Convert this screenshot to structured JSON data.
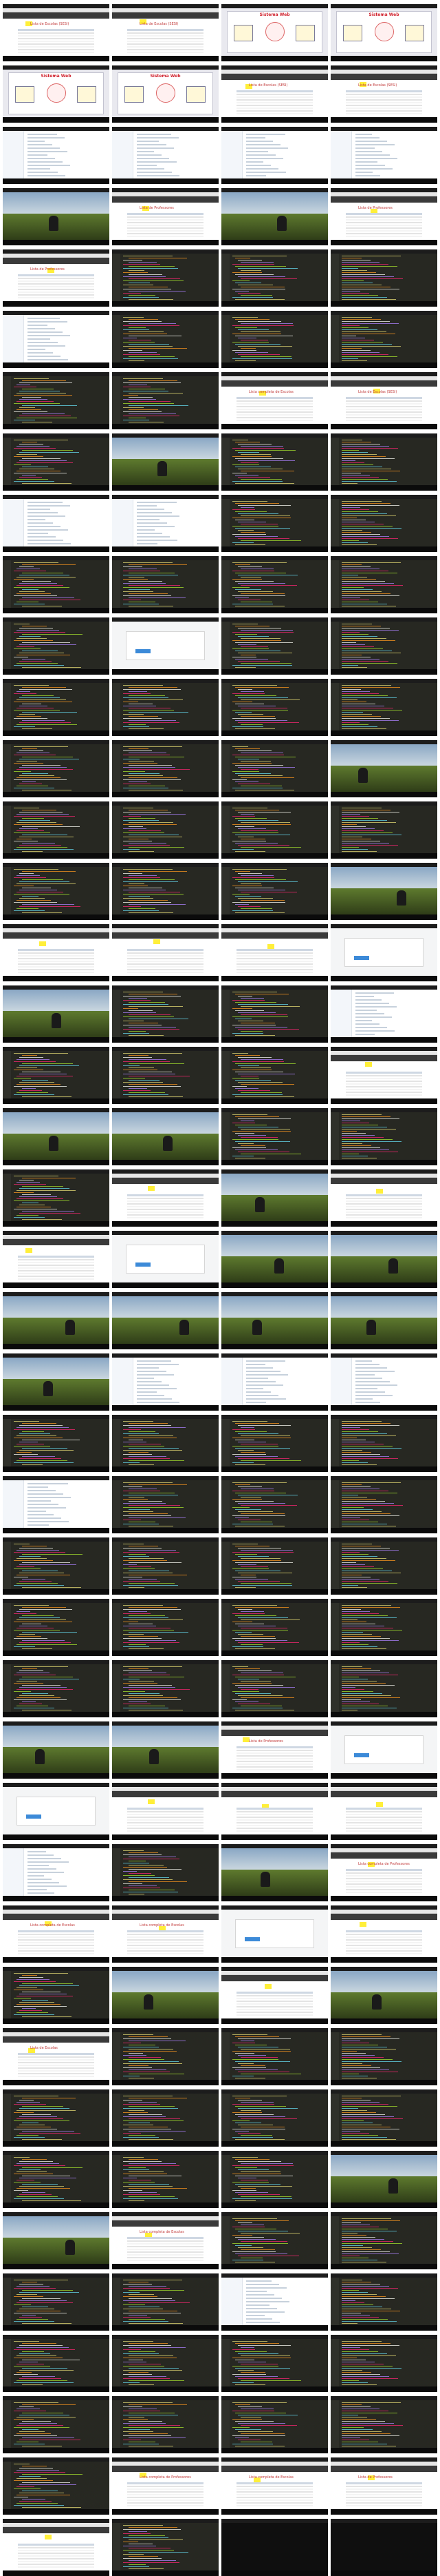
{
  "sheet": {
    "columns": 4,
    "rows": 39,
    "filled_cells": 155
  },
  "cells": [
    {
      "type": "web",
      "title": "Lista de Escolas (SESI)"
    },
    {
      "type": "web",
      "title": "Lista de Escolas (SESI)"
    },
    {
      "type": "diagram",
      "title": "Sistema Web"
    },
    {
      "type": "diagram",
      "title": "Sistema Web"
    },
    {
      "type": "diagram",
      "title": "Sistema Web"
    },
    {
      "type": "diagram",
      "title": "Sistema Web"
    },
    {
      "type": "web",
      "title": "Lista de Escolas (SESI)"
    },
    {
      "type": "web",
      "title": "Lista de Escolas (SESI)"
    },
    {
      "type": "explorer"
    },
    {
      "type": "explorer"
    },
    {
      "type": "explorer"
    },
    {
      "type": "explorer"
    },
    {
      "type": "photo",
      "caption": ""
    },
    {
      "type": "web",
      "title": "Lista de Professores"
    },
    {
      "type": "photo",
      "caption": ""
    },
    {
      "type": "web",
      "title": "Lista de Professores"
    },
    {
      "type": "web",
      "title": "Lista de Professores"
    },
    {
      "type": "code"
    },
    {
      "type": "code"
    },
    {
      "type": "code"
    },
    {
      "type": "explorer"
    },
    {
      "type": "code"
    },
    {
      "type": "code"
    },
    {
      "type": "code"
    },
    {
      "type": "code"
    },
    {
      "type": "code"
    },
    {
      "type": "web",
      "title": "Lista completa de Escolas"
    },
    {
      "type": "web",
      "title": "Lista de Escolas (SESI)"
    },
    {
      "type": "code"
    },
    {
      "type": "photo",
      "caption": ""
    },
    {
      "type": "code"
    },
    {
      "type": "code"
    },
    {
      "type": "explorer"
    },
    {
      "type": "explorer"
    },
    {
      "type": "code"
    },
    {
      "type": "code"
    },
    {
      "type": "code"
    },
    {
      "type": "code"
    },
    {
      "type": "code"
    },
    {
      "type": "code"
    },
    {
      "type": "code"
    },
    {
      "type": "dialog"
    },
    {
      "type": "code"
    },
    {
      "type": "code"
    },
    {
      "type": "code"
    },
    {
      "type": "code"
    },
    {
      "type": "code"
    },
    {
      "type": "code"
    },
    {
      "type": "code"
    },
    {
      "type": "code"
    },
    {
      "type": "code"
    },
    {
      "type": "photo",
      "caption": ""
    },
    {
      "type": "code"
    },
    {
      "type": "code"
    },
    {
      "type": "code"
    },
    {
      "type": "code"
    },
    {
      "type": "code"
    },
    {
      "type": "code"
    },
    {
      "type": "code"
    },
    {
      "type": "photo",
      "caption": ""
    },
    {
      "type": "web",
      "title": ""
    },
    {
      "type": "web",
      "title": ""
    },
    {
      "type": "web",
      "title": ""
    },
    {
      "type": "dialog"
    },
    {
      "type": "photo",
      "caption": ""
    },
    {
      "type": "code"
    },
    {
      "type": "code"
    },
    {
      "type": "explorer"
    },
    {
      "type": "code"
    },
    {
      "type": "code"
    },
    {
      "type": "code"
    },
    {
      "type": "web",
      "title": ""
    },
    {
      "type": "photo",
      "caption": ""
    },
    {
      "type": "photo",
      "caption": ""
    },
    {
      "type": "code"
    },
    {
      "type": "code"
    },
    {
      "type": "code"
    },
    {
      "type": "web",
      "title": ""
    },
    {
      "type": "photo",
      "caption": ""
    },
    {
      "type": "web",
      "title": ""
    },
    {
      "type": "web",
      "title": ""
    },
    {
      "type": "dialog"
    },
    {
      "type": "photo",
      "caption": ""
    },
    {
      "type": "photo",
      "caption": ""
    },
    {
      "type": "photo",
      "caption": ""
    },
    {
      "type": "photo",
      "caption": ""
    },
    {
      "type": "photo",
      "caption": ""
    },
    {
      "type": "photo",
      "caption": ""
    },
    {
      "type": "photo",
      "caption": ""
    },
    {
      "type": "explorer"
    },
    {
      "type": "explorer"
    },
    {
      "type": "explorer"
    },
    {
      "type": "code"
    },
    {
      "type": "code"
    },
    {
      "type": "code"
    },
    {
      "type": "code"
    },
    {
      "type": "explorer"
    },
    {
      "type": "code"
    },
    {
      "type": "code"
    },
    {
      "type": "code"
    },
    {
      "type": "code"
    },
    {
      "type": "code"
    },
    {
      "type": "code"
    },
    {
      "type": "code"
    },
    {
      "type": "code"
    },
    {
      "type": "code"
    },
    {
      "type": "code"
    },
    {
      "type": "code"
    },
    {
      "type": "code"
    },
    {
      "type": "code"
    },
    {
      "type": "code"
    },
    {
      "type": "code"
    },
    {
      "type": "photo",
      "caption": ""
    },
    {
      "type": "photo",
      "caption": ""
    },
    {
      "type": "web",
      "title": "Lista de Professores"
    },
    {
      "type": "dialog"
    },
    {
      "type": "dialog"
    },
    {
      "type": "web",
      "title": ""
    },
    {
      "type": "web",
      "title": ""
    },
    {
      "type": "web",
      "title": ""
    },
    {
      "type": "explorer"
    },
    {
      "type": "code"
    },
    {
      "type": "photo",
      "caption": ""
    },
    {
      "type": "web",
      "title": "Lista completa de Professores"
    },
    {
      "type": "web",
      "title": "Lista completa de Escolas"
    },
    {
      "type": "web",
      "title": "Lista completa de Escolas"
    },
    {
      "type": "dialog"
    },
    {
      "type": "web",
      "title": ""
    },
    {
      "type": "code"
    },
    {
      "type": "photo",
      "caption": ""
    },
    {
      "type": "web",
      "title": ""
    },
    {
      "type": "photo",
      "caption": ""
    },
    {
      "type": "web",
      "title": "Lista de Escolas"
    },
    {
      "type": "code"
    },
    {
      "type": "code"
    },
    {
      "type": "code"
    },
    {
      "type": "code"
    },
    {
      "type": "code"
    },
    {
      "type": "code"
    },
    {
      "type": "code"
    },
    {
      "type": "code"
    },
    {
      "type": "code"
    },
    {
      "type": "code"
    },
    {
      "type": "photo",
      "caption": ""
    },
    {
      "type": "photo",
      "caption": ""
    },
    {
      "type": "web",
      "title": "Lista completa de Escolas"
    },
    {
      "type": "code"
    },
    {
      "type": "code"
    },
    {
      "type": "code"
    },
    {
      "type": "code"
    },
    {
      "type": "explorer"
    },
    {
      "type": "code"
    },
    {
      "type": "code"
    },
    {
      "type": "code"
    },
    {
      "type": "code"
    },
    {
      "type": "code"
    },
    {
      "type": "code"
    },
    {
      "type": "code"
    },
    {
      "type": "code"
    },
    {
      "type": "code"
    },
    {
      "type": "code"
    },
    {
      "type": "web",
      "title": "Lista completa de Professores"
    },
    {
      "type": "web",
      "title": "Lista completa de Escolas"
    },
    {
      "type": "web",
      "title": "Lista de Professores"
    },
    {
      "type": "web",
      "title": ""
    },
    {
      "type": "code"
    },
    {
      "type": "empty"
    },
    {
      "type": "empty"
    }
  ]
}
